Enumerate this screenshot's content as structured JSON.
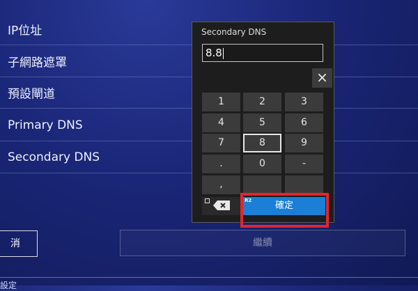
{
  "settings": {
    "rows": [
      {
        "label": "IP位址"
      },
      {
        "label": "子網路遮罩"
      },
      {
        "label": "預設閘道"
      },
      {
        "label": "Primary DNS"
      },
      {
        "label": "Secondary DNS"
      }
    ],
    "back_label": "消",
    "next_label": "繼續",
    "footer_text": "設定"
  },
  "dialog": {
    "title": "Secondary DNS",
    "input_value": "8.8",
    "close_icon": "×",
    "keys": [
      "1",
      "2",
      "3",
      "4",
      "5",
      "6",
      "7",
      "8",
      "9",
      ".",
      "0",
      "-",
      ","
    ],
    "selected_key": "8",
    "backspace_icon": "backspace-icon",
    "confirm_label": "確定",
    "confirm_badge": "R2"
  },
  "colors": {
    "background": "#1a2677",
    "dialog_bg": "#1d1d1d",
    "confirm_blue": "#1b7fd8",
    "highlight_red": "#e0262e"
  }
}
